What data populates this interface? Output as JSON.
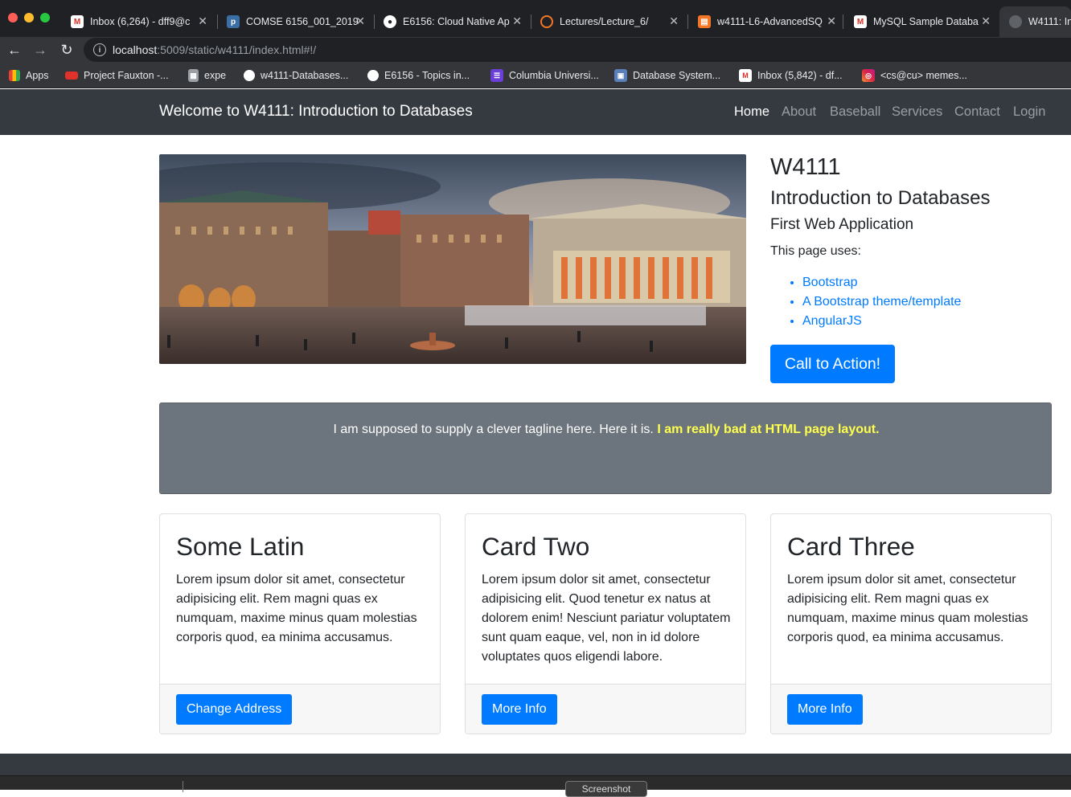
{
  "browser": {
    "tabs": [
      {
        "title": "Inbox (6,264) - dff9@c",
        "icon": "gmail-icon"
      },
      {
        "title": "COMSE 6156_001_2019",
        "icon": "p-icon"
      },
      {
        "title": "E6156: Cloud Native Ap",
        "icon": "globe-icon"
      },
      {
        "title": "Lectures/Lecture_6/",
        "icon": "jupyter-icon"
      },
      {
        "title": "w4111-L6-AdvancedSQ",
        "icon": "book-icon"
      },
      {
        "title": "MySQL Sample Databa",
        "icon": "m-icon"
      },
      {
        "title": "W4111: In",
        "icon": "globe-icon"
      }
    ],
    "url_host": "localhost",
    "url_rest": ":5009/static/w4111/index.html#!/",
    "bookmarks": [
      {
        "label": "Apps",
        "icon": "apps-grid-icon"
      },
      {
        "label": "Project Fauxton -...",
        "icon": "couch-icon"
      },
      {
        "label": "expe",
        "icon": "building-icon"
      },
      {
        "label": "w4111-Databases...",
        "icon": "globe-icon"
      },
      {
        "label": "E6156 - Topics in...",
        "icon": "globe-icon"
      },
      {
        "label": "Columbia Universi...",
        "icon": "list-icon"
      },
      {
        "label": "Database System...",
        "icon": "screen-icon"
      },
      {
        "label": "Inbox (5,842) - df...",
        "icon": "gmail-icon"
      },
      {
        "label": "<cs@cu> memes...",
        "icon": "instagram-icon"
      }
    ]
  },
  "navbar": {
    "brand": "Welcome to W4111: Introduction to Databases",
    "links": [
      "Home",
      "About",
      "Baseball",
      "Services",
      "Contact",
      "Login"
    ]
  },
  "hero": {
    "h1": "W4111",
    "h2": "Introduction to Databases",
    "h3": "First Web Application",
    "uses_text": "This page uses:",
    "uses": [
      "Bootstrap",
      "A Bootstrap theme/template",
      "AngularJS"
    ],
    "cta": "Call to Action!"
  },
  "tagline": {
    "text": "I am supposed to supply a clever tagline here. Here it is.",
    "highlight": "I am really bad at HTML page layout."
  },
  "cards": [
    {
      "title": "Some Latin",
      "text": "Lorem ipsum dolor sit amet, consectetur adipisicing elit. Rem magni quas ex numquam, maxime minus quam molestias corporis quod, ea minima accusamus.",
      "button": "Change Address"
    },
    {
      "title": "Card Two",
      "text": "Lorem ipsum dolor sit amet, consectetur adipisicing elit. Quod tenetur ex natus at dolorem enim! Nesciunt pariatur voluptatem sunt quam eaque, vel, non in id dolore voluptates quos eligendi labore.",
      "button": "More Info"
    },
    {
      "title": "Card Three",
      "text": "Lorem ipsum dolor sit amet, consectetur adipisicing elit. Rem magni quas ex numquam, maxime minus quam molestias corporis quod, ea minima accusamus.",
      "button": "More Info"
    }
  ],
  "bottombar": {
    "screenshot_label": "Screenshot"
  },
  "colors": {
    "primary": "#007bff",
    "navbar": "#343a40",
    "tagline_bg": "#6c757d",
    "highlight": "#ffff4d"
  }
}
